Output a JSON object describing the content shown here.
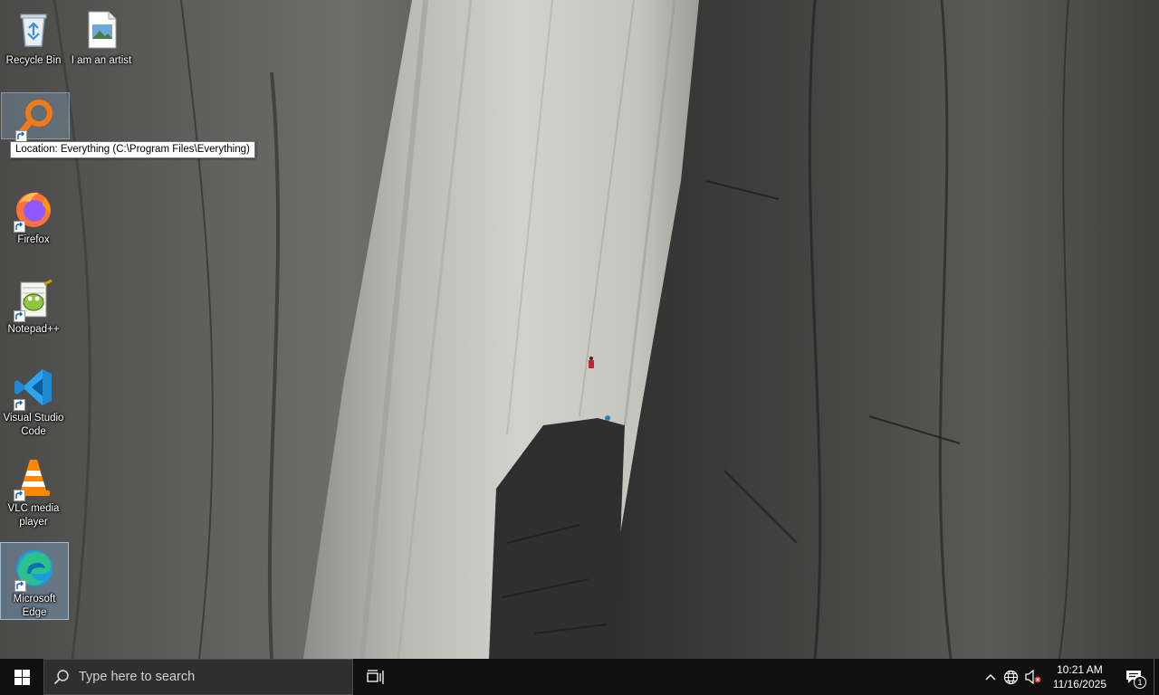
{
  "desktop": {
    "icons": [
      {
        "label": "Recycle Bin",
        "icon": "recycle-bin-icon",
        "shortcut": false
      },
      {
        "label": "I am an artist",
        "icon": "image-file-icon",
        "shortcut": false
      },
      {
        "label": "",
        "icon": "everything-search-icon",
        "shortcut": true
      },
      {
        "label": "Firefox",
        "icon": "firefox-icon",
        "shortcut": true
      },
      {
        "label": "Notepad++",
        "icon": "notepad-plus-plus-icon",
        "shortcut": true
      },
      {
        "label": "Visual Studio Code",
        "icon": "vscode-icon",
        "shortcut": true
      },
      {
        "label": "VLC media player",
        "icon": "vlc-icon",
        "shortcut": true
      },
      {
        "label": "Microsoft Edge",
        "icon": "edge-icon",
        "shortcut": true
      }
    ],
    "tooltip": "Location: Everything (C:\\Program Files\\Everything)"
  },
  "taskbar": {
    "start_icon": "windows-logo-icon",
    "search_placeholder": "Type here to search",
    "taskview_icon": "task-view-icon",
    "tray": {
      "chevron_icon": "chevron-up-icon",
      "network_icon": "globe-network-icon",
      "volume_icon": "speaker-muted-icon",
      "time": "10:21 AM",
      "date": "11/16/2025",
      "notification_count": "1",
      "notification_icon": "action-center-icon"
    }
  },
  "colors": {
    "taskbar": "#101010",
    "search_bg": "#2f2f2f",
    "selection": "#96c8fa"
  }
}
